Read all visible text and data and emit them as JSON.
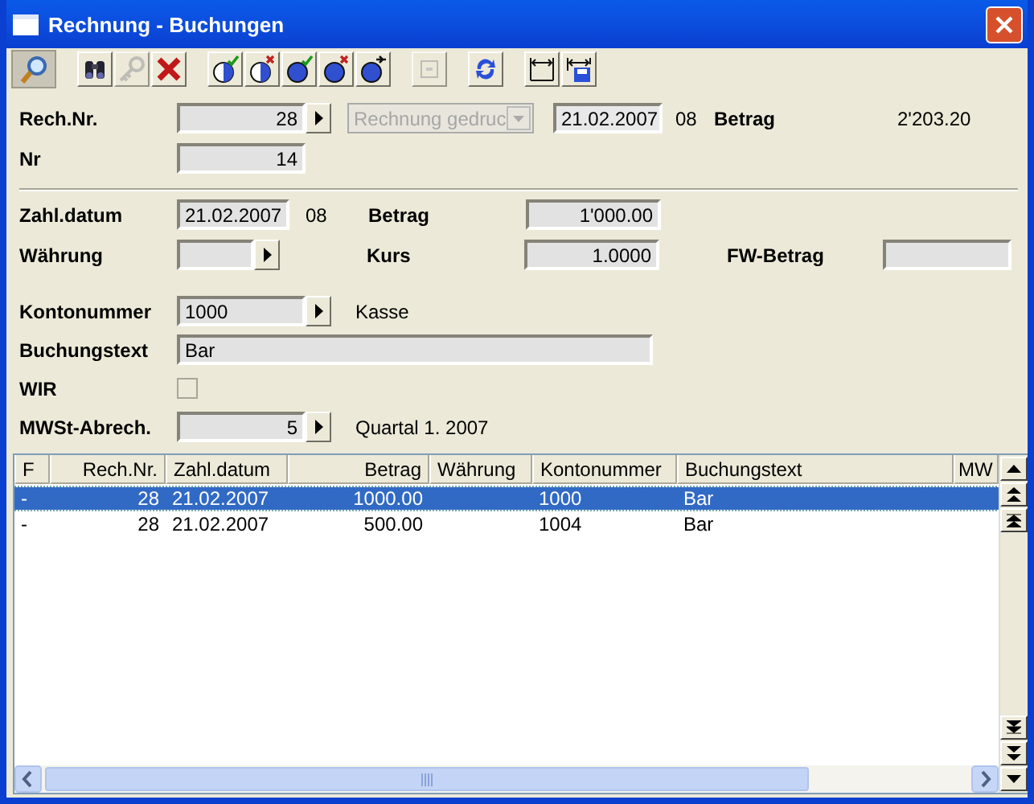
{
  "window": {
    "title": "Rechnung - Buchungen"
  },
  "toolbar": [
    {
      "kind": "search",
      "pressed": true,
      "disabled": false
    },
    {
      "kind": "find",
      "pressed": false,
      "disabled": false
    },
    {
      "kind": "key",
      "pressed": false,
      "disabled": true
    },
    {
      "kind": "delete",
      "pressed": false,
      "disabled": false
    },
    {
      "kind": "half-check",
      "pressed": false,
      "disabled": false
    },
    {
      "kind": "half-cross",
      "pressed": false,
      "disabled": false
    },
    {
      "kind": "full-check",
      "pressed": false,
      "disabled": false
    },
    {
      "kind": "full-cross",
      "pressed": false,
      "disabled": false
    },
    {
      "kind": "full-arrows",
      "pressed": false,
      "disabled": false
    },
    {
      "kind": "blank",
      "pressed": false,
      "disabled": true
    },
    {
      "kind": "refresh",
      "pressed": false,
      "disabled": false
    },
    {
      "kind": "fit-width",
      "pressed": false,
      "disabled": false
    },
    {
      "kind": "fit-save",
      "pressed": false,
      "disabled": false
    }
  ],
  "invoice": {
    "label": "Rech.Nr.",
    "number": "28",
    "status": {
      "value": "Rechnung gedruc",
      "disabled": true
    },
    "date": "21.02.2007",
    "period": "08",
    "amount_label": "Betrag",
    "amount": "2'203.20"
  },
  "nr": {
    "label": "Nr",
    "value": "14"
  },
  "payment": {
    "date_label": "Zahl.datum",
    "date": "21.02.2007",
    "period": "08",
    "amount_label": "Betrag",
    "amount": "1'000.00",
    "currency_label": "Währung",
    "rate_label": "Kurs",
    "rate": "1.0000",
    "fw_label": "FW-Betrag"
  },
  "account": {
    "label": "Kontonummer",
    "value": "1000",
    "name": "Kasse"
  },
  "booking_text": {
    "label": "Buchungstext",
    "value": "Bar"
  },
  "wir": {
    "label": "WIR",
    "checked": false
  },
  "vat": {
    "label": "MWSt-Abrech.",
    "value": "5",
    "period": "Quartal 1. 2007"
  },
  "table": {
    "columns": [
      "F",
      "Rech.Nr.",
      "Zahl.datum",
      "Betrag",
      "Währung",
      "Kontonummer",
      "Buchungstext",
      "MW"
    ],
    "rows": [
      {
        "selected": true,
        "cells": [
          "-",
          "28",
          "21.02.2007",
          "1000.00",
          null,
          "1000",
          "Bar"
        ]
      },
      {
        "selected": false,
        "cells": [
          "-",
          "28",
          "21.02.2007",
          "500.00",
          null,
          "1004",
          "Bar"
        ]
      }
    ]
  }
}
